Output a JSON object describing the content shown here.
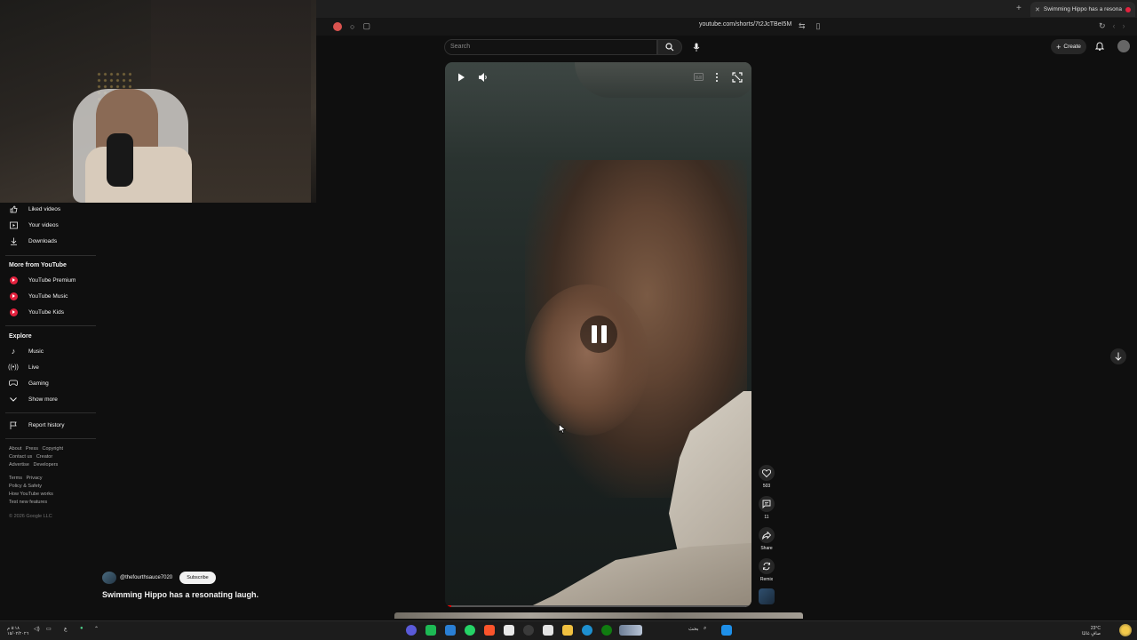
{
  "browser": {
    "tab_title": "Swimming Hippo has a resona",
    "url": "youtube.com/shorts/7t2JcTBeI5M",
    "new_tab_symbol": "+"
  },
  "header": {
    "search_placeholder": "Search",
    "create_label": "Create"
  },
  "sidebar": {
    "items_top": [
      {
        "label": "Liked videos",
        "icon": "thumb-up-icon"
      },
      {
        "label": "Your videos",
        "icon": "play-square-icon"
      },
      {
        "label": "Downloads",
        "icon": "download-icon"
      }
    ],
    "more_heading": "More from YouTube",
    "more_items": [
      {
        "label": "YouTube Premium"
      },
      {
        "label": "YouTube Music"
      },
      {
        "label": "YouTube Kids"
      }
    ],
    "explore_heading": "Explore",
    "explore_items": [
      {
        "label": "Music",
        "icon": "music-note-icon"
      },
      {
        "label": "Live",
        "icon": "live-icon"
      },
      {
        "label": "Gaming",
        "icon": "gamepad-icon"
      },
      {
        "label": "Show more",
        "icon": "chevron-down-icon"
      }
    ],
    "report_history": "Report history",
    "footer1": [
      "About",
      "Press",
      "Copyright",
      "Contact us",
      "Creator",
      "Advertise",
      "Developers"
    ],
    "footer2": [
      "Terms",
      "Privacy",
      "Policy & Safety",
      "How YouTube works",
      "Test new features"
    ],
    "copyright": "© 2026 Google LLC"
  },
  "video": {
    "channel": "@thefourthsauce7020",
    "subscribe_label": "Subscribe",
    "title": "Swimming Hippo has a resonating laugh.",
    "progress_fraction": 0.02
  },
  "actions": {
    "likes": "503",
    "comments": "11",
    "share_label": "Share",
    "remix_label": "Remix"
  },
  "taskbar": {
    "time": "٥:١٨ م",
    "date": "١٥/٠٢/٢٠٢٦",
    "weather_temp": "23°C",
    "weather_text": "صافٍ غالبًا",
    "search_label": "بحث",
    "lang": "ع"
  },
  "colors": {
    "background": "#0f0f0f",
    "youtube_red": "#e3223e",
    "progress": "#ff0000"
  }
}
